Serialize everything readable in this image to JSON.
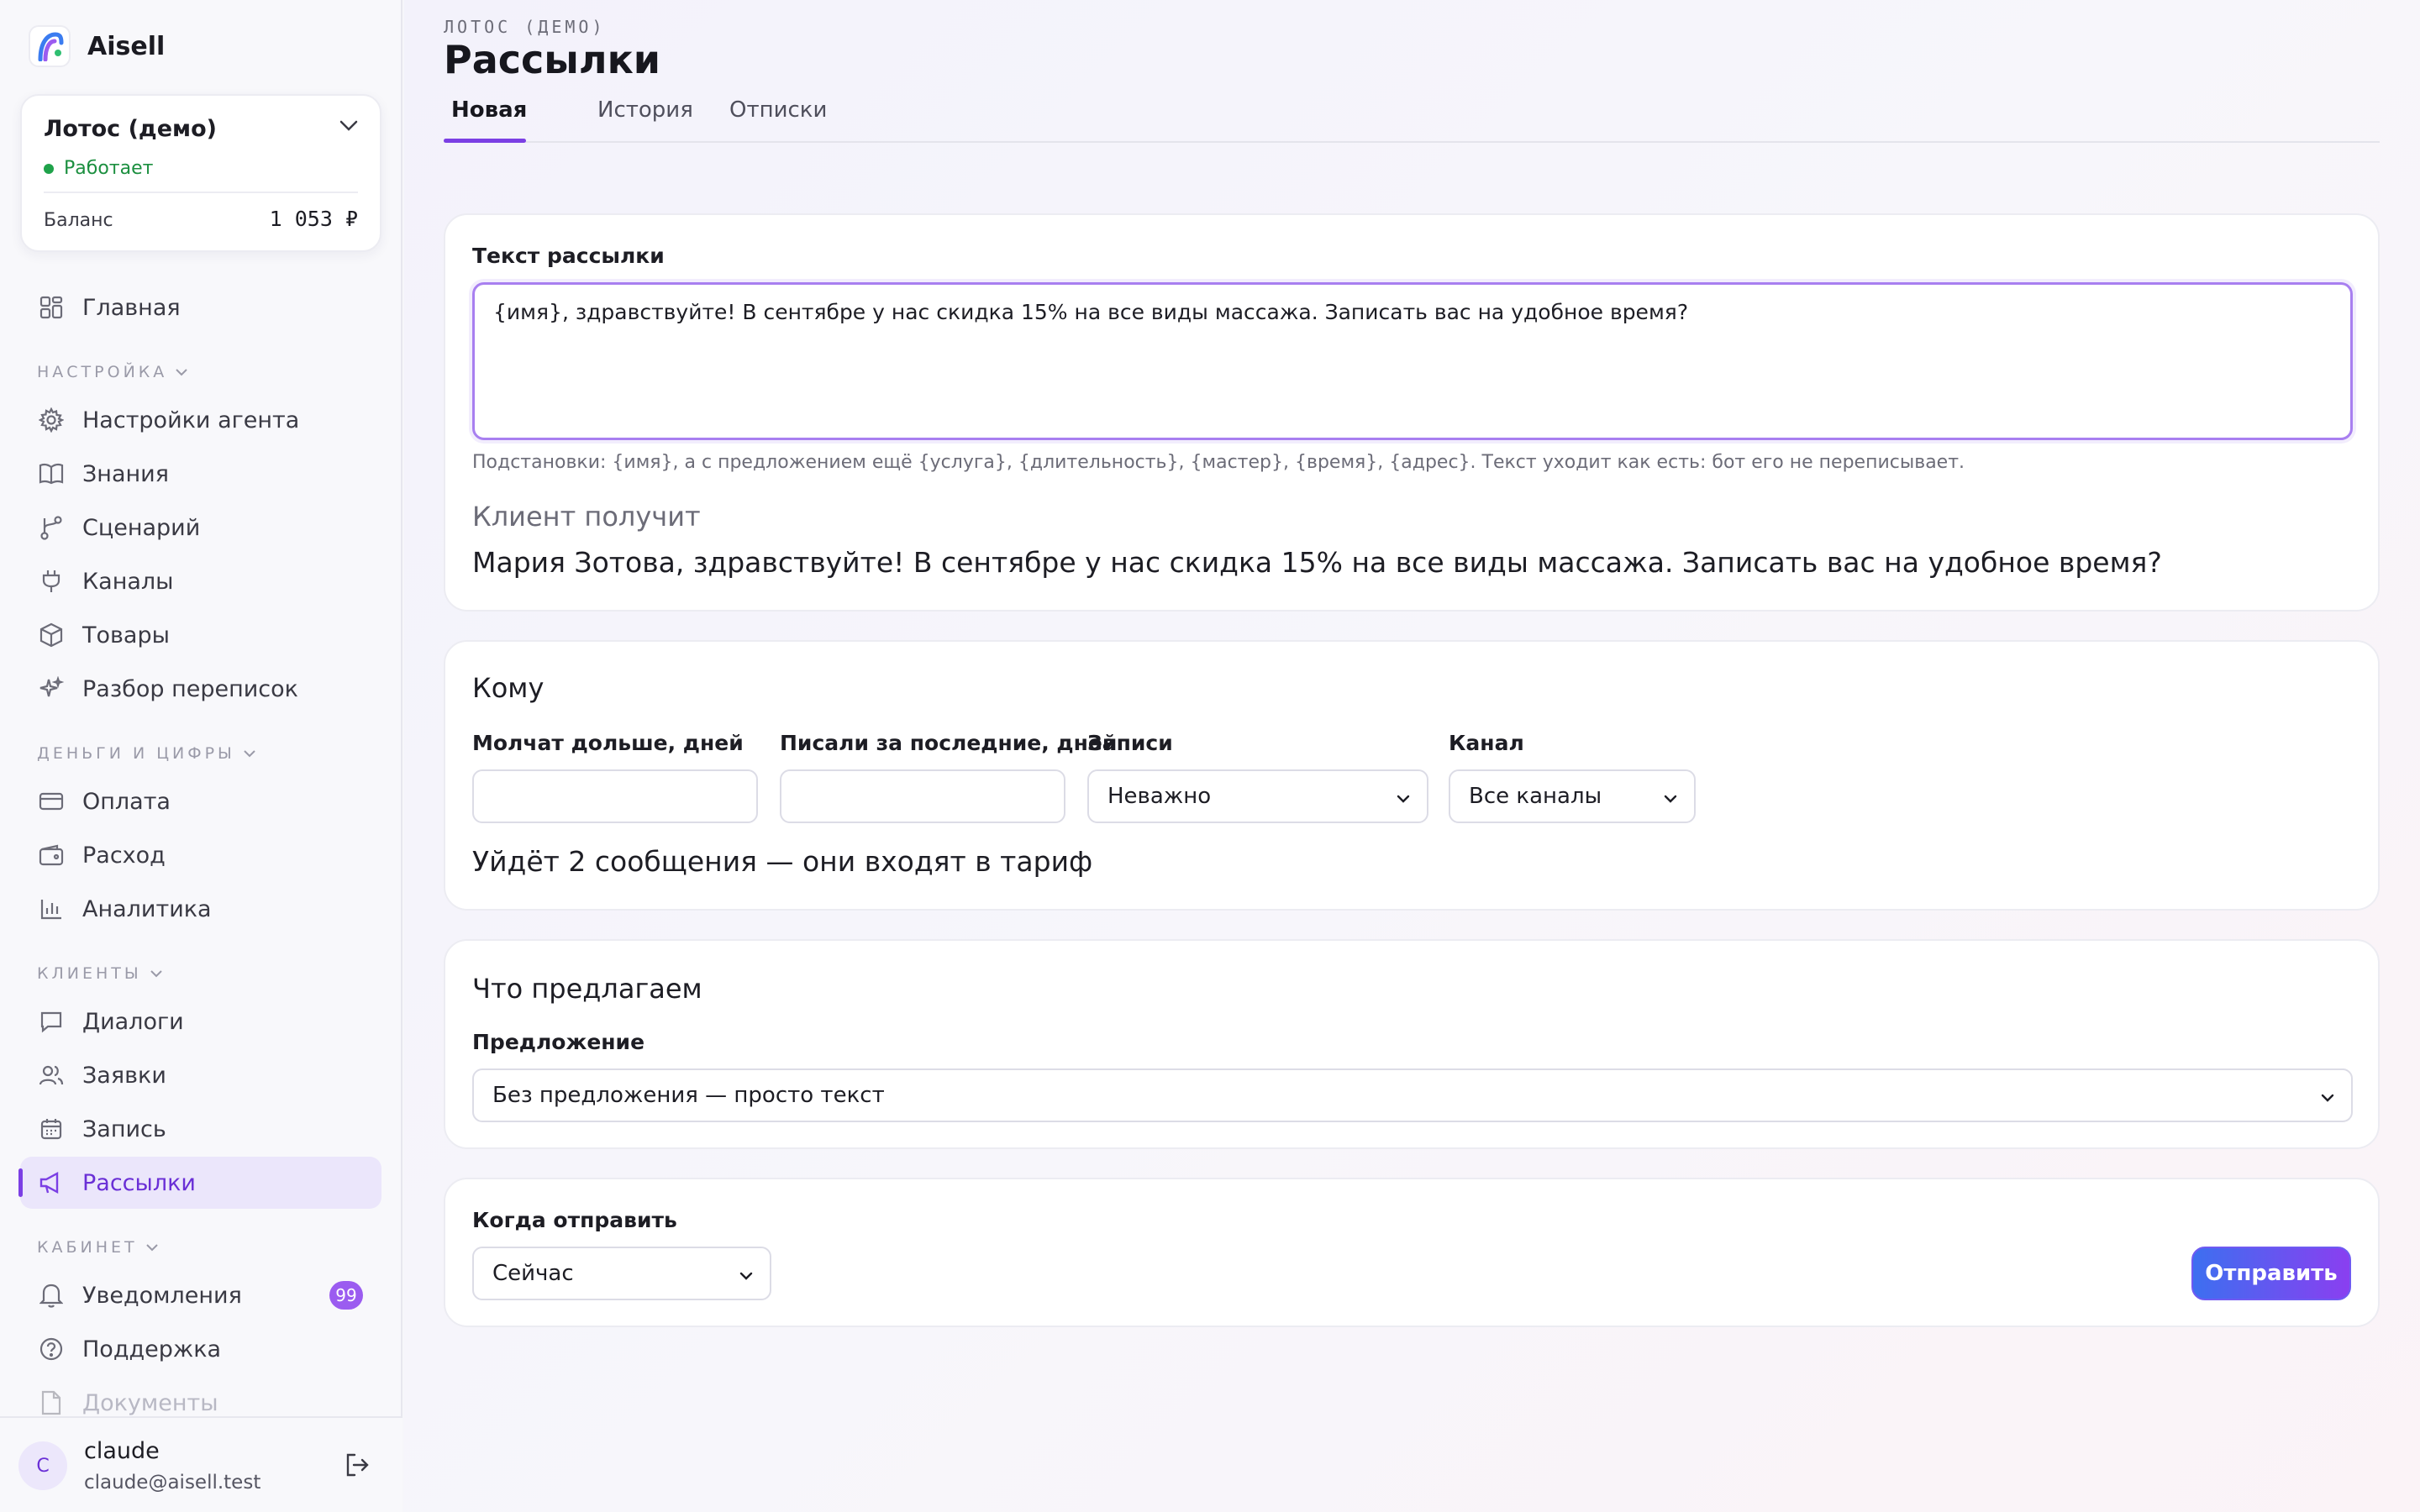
{
  "brand": {
    "name": "Aisell"
  },
  "org": {
    "name": "Лотос (демо)",
    "status": "Работает",
    "balance_label": "Баланс",
    "balance_value": "1 053 ₽"
  },
  "nav": {
    "home": "Главная",
    "section_settings": "НАСТРОЙКА",
    "agent_settings": "Настройки агента",
    "knowledge": "Знания",
    "scenario": "Сценарий",
    "channels": "Каналы",
    "products": "Товары",
    "chat_review": "Разбор переписок",
    "section_money": "ДЕНЬГИ И ЦИФРЫ",
    "payment": "Оплата",
    "expense": "Расход",
    "analytics": "Аналитика",
    "section_clients": "КЛИЕНТЫ",
    "dialogs": "Диалоги",
    "requests": "Заявки",
    "booking": "Запись",
    "mailings": "Рассылки",
    "section_cabinet": "КАБИНЕТ",
    "notifications": "Уведомления",
    "notifications_count": "99",
    "support": "Поддержка",
    "documents": "Документы"
  },
  "user": {
    "initial": "C",
    "name": "claude",
    "email": "claude@aisell.test"
  },
  "header": {
    "breadcrumb": "ЛОТОС (ДЕМО)",
    "title": "Рассылки",
    "tabs": [
      "Новая",
      "История",
      "Отписки"
    ]
  },
  "message_card": {
    "label": "Текст рассылки",
    "text": "{имя}, здравствуйте! В сентябре у нас скидка 15% на все виды массажа. Записать вас на удобное время?",
    "hint": "Подстановки: {имя}, а с предложением ещё {услуга}, {длительность}, {мастер}, {время}, {адрес}. Текст уходит как есть: бот его не переписывает.",
    "preview_label": "Клиент получит",
    "preview_text": "Мария Зотова, здравствуйте! В сентябре у нас скидка 15% на все виды массажа. Записать вас на удобное время?"
  },
  "audience_card": {
    "heading": "Кому",
    "silent_label": "Молчат дольше, дней",
    "silent_value": "",
    "wrote_label": "Писали за последние, дней",
    "wrote_value": "",
    "bookings_label": "Записи",
    "bookings_value": "Неважно",
    "channel_label": "Канал",
    "channel_value": "Все каналы",
    "summary": "Уйдёт 2 сообщения — они входят в тариф"
  },
  "offer_card": {
    "heading": "Что предлагаем",
    "label": "Предложение",
    "value": "Без предложения — просто текст"
  },
  "schedule_card": {
    "label": "Когда отправить",
    "value": "Сейчас",
    "send_button": "Отправить"
  }
}
